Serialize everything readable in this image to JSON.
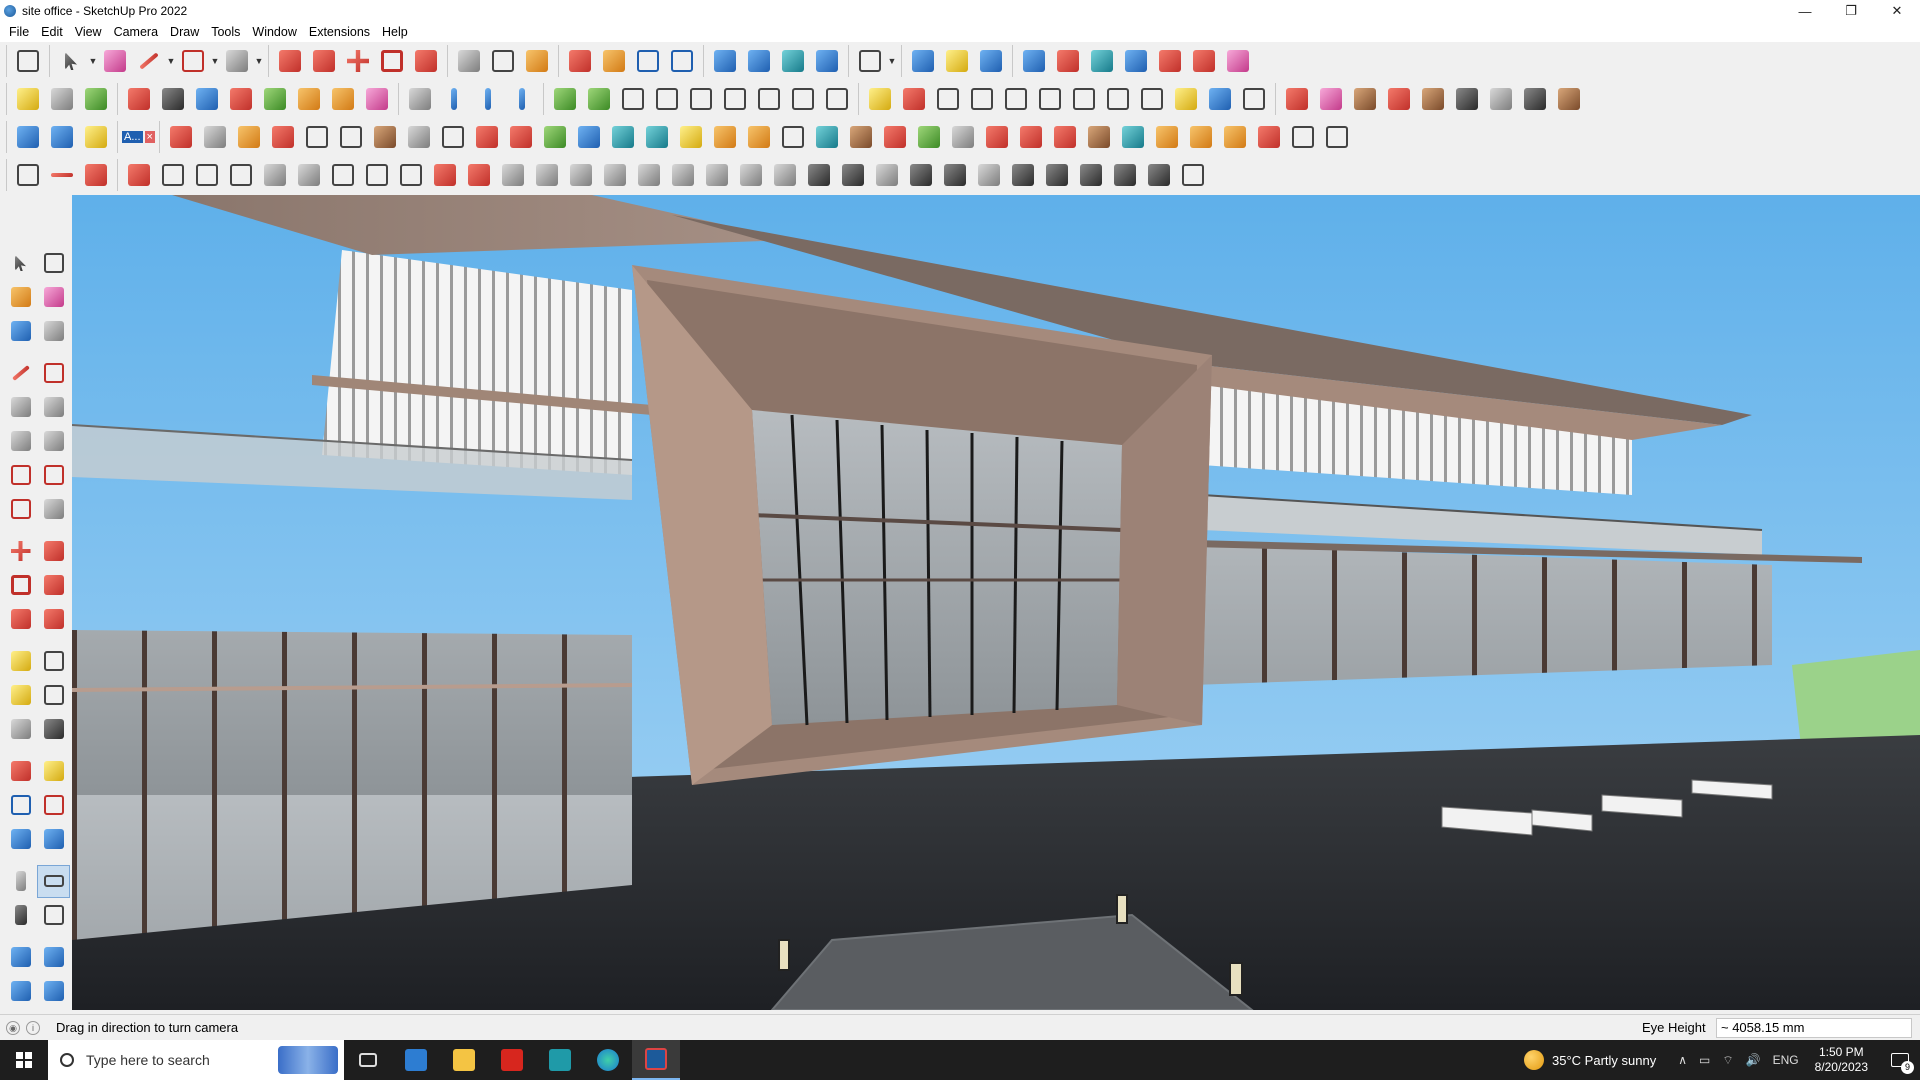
{
  "window": {
    "title": "site office - SketchUp Pro 2022",
    "controls": {
      "minimize": "—",
      "restore": "❐",
      "close": "✕"
    }
  },
  "menu": [
    "File",
    "Edit",
    "View",
    "Camera",
    "Draw",
    "Tools",
    "Window",
    "Extensions",
    "Help"
  ],
  "toolbars": {
    "row1": [
      "zoom-extents",
      "select",
      "eraser",
      "line",
      "arc",
      "rectangle",
      "push-pull",
      "follow-me",
      "move",
      "rotate",
      "scale",
      "tape-measure",
      "text",
      "paint-bucket",
      "orbit",
      "pan",
      "zoom",
      "zoom-window",
      "section-plane",
      "layers",
      "styles",
      "components",
      "user-account",
      "warehouse",
      "extension-warehouse",
      "sandbox",
      "solid-tools"
    ],
    "row2_label": "A...",
    "row2_close": "×"
  },
  "status": {
    "hint": "Drag in direction to turn camera",
    "eye_height_label": "Eye Height",
    "eye_height_value": "~ 4058.15 mm"
  },
  "taskbar": {
    "search_placeholder": "Type here to search",
    "weather": "35°C  Partly sunny",
    "language": "ENG",
    "time": "1:50 PM",
    "date": "8/20/2023",
    "notification_count": "9"
  },
  "colors": {
    "sky": "#7fc0ee",
    "roof_underside": "#a58a7c",
    "roof_top": "#7a6a62",
    "ground": "#2f3236",
    "glass": "#9ea4a8",
    "taskbar": "#1e1e1e"
  }
}
